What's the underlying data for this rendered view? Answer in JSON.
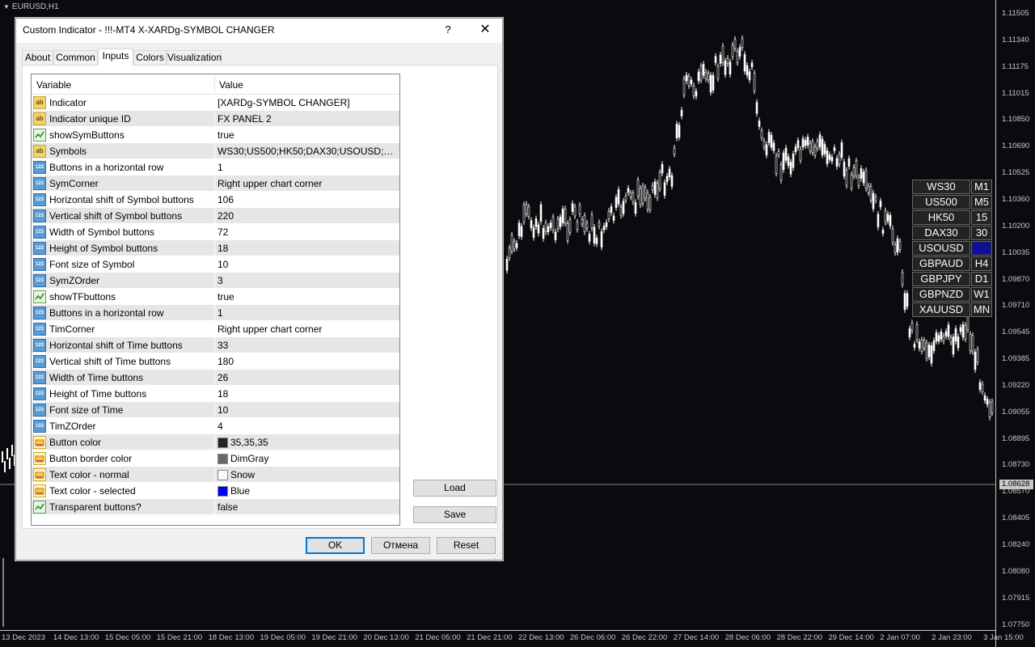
{
  "chart": {
    "title": "EURUSD,H1",
    "current_price": "1.08628",
    "price_labels": [
      "1.11505",
      "1.11340",
      "1.11175",
      "1.11015",
      "1.10850",
      "1.10690",
      "1.10525",
      "1.10360",
      "1.10200",
      "1.10035",
      "1.09870",
      "1.09710",
      "1.09545",
      "1.09385",
      "1.09220",
      "1.09055",
      "1.08895",
      "1.08730",
      "1.08570",
      "1.08405",
      "1.08240",
      "1.08080",
      "1.07915",
      "1.07750"
    ],
    "time_labels": [
      "13 Dec 2023",
      "14 Dec 13:00",
      "15 Dec 05:00",
      "15 Dec 21:00",
      "18 Dec 13:00",
      "19 Dec 05:00",
      "19 Dec 21:00",
      "20 Dec 13:00",
      "21 Dec 05:00",
      "21 Dec 21:00",
      "22 Dec 13:00",
      "26 Dec 06:00",
      "26 Dec 22:00",
      "27 Dec 14:00",
      "28 Dec 06:00",
      "28 Dec 22:00",
      "29 Dec 14:00",
      "2 Jan 07:00",
      "2 Jan 23:00",
      "3 Jan 15:00"
    ],
    "symbol_buttons": [
      "WS30",
      "US500",
      "HK50",
      "DAX30",
      "USOUSD",
      "GBPAUD",
      "GBPJPY",
      "GBPNZD",
      "XAUUSD"
    ],
    "timeframe_buttons": [
      "M1",
      "M5",
      "15",
      "30",
      "H1",
      "H4",
      "D1",
      "W1",
      "MN"
    ],
    "selected_timeframe": "H1",
    "colors": {
      "bg": "#0b0b0f",
      "candle": "#ffffff",
      "axis": "#c8c8c8",
      "button": "#232323",
      "button_border": "#696969",
      "text_normal": "#fffafa",
      "text_selected": "#0000ff"
    }
  },
  "dialog": {
    "title": "Custom Indicator - !!!-MT4 X-XARDg-SYMBOL CHANGER",
    "help": "?",
    "close": "✕",
    "tabs": [
      "About",
      "Common",
      "Inputs",
      "Colors",
      "Visualization"
    ],
    "active_tab": "Inputs",
    "grid": {
      "col_variable": "Variable",
      "col_value": "Value",
      "rows": [
        {
          "icon": "ab",
          "variable": "Indicator",
          "value": "[XARDg-SYMBOL CHANGER]"
        },
        {
          "icon": "ab",
          "variable": "Indicator unique ID",
          "value": "FX PANEL 2"
        },
        {
          "icon": "bool",
          "variable": "showSymButtons",
          "value": "true"
        },
        {
          "icon": "ab",
          "variable": "Symbols",
          "value": "WS30;US500;HK50;DAX30;USOUSD;GBP..."
        },
        {
          "icon": "num",
          "variable": "Buttons in a horizontal row",
          "value": "1"
        },
        {
          "icon": "num",
          "variable": "SymCorner",
          "value": "Right upper chart corner"
        },
        {
          "icon": "num",
          "variable": "Horizontal shift of Symbol buttons",
          "value": "106"
        },
        {
          "icon": "num",
          "variable": "Vertical shift of Symbol buttons",
          "value": "220"
        },
        {
          "icon": "num",
          "variable": "Width of Symbol buttons",
          "value": "72"
        },
        {
          "icon": "num",
          "variable": "Height of Symbol buttons",
          "value": "18"
        },
        {
          "icon": "num",
          "variable": "Font size of Symbol",
          "value": "10"
        },
        {
          "icon": "num",
          "variable": "SymZOrder",
          "value": "3"
        },
        {
          "icon": "bool",
          "variable": "showTFbuttons",
          "value": "true"
        },
        {
          "icon": "num",
          "variable": "Buttons in a horizontal row",
          "value": "1"
        },
        {
          "icon": "num",
          "variable": "TimCorner",
          "value": "Right upper chart corner"
        },
        {
          "icon": "num",
          "variable": "Horizontal shift of Time buttons",
          "value": "33"
        },
        {
          "icon": "num",
          "variable": "Vertical shift of Time buttons",
          "value": "180"
        },
        {
          "icon": "num",
          "variable": "Width of Time buttons",
          "value": "26"
        },
        {
          "icon": "num",
          "variable": "Height of Time buttons",
          "value": "18"
        },
        {
          "icon": "num",
          "variable": "Font size of Time",
          "value": "10"
        },
        {
          "icon": "num",
          "variable": "TimZOrder",
          "value": "4"
        },
        {
          "icon": "color",
          "variable": "Button color",
          "value": "35,35,35",
          "swatch": "#232323"
        },
        {
          "icon": "color",
          "variable": "Button border color",
          "value": "DimGray",
          "swatch": "#696969"
        },
        {
          "icon": "color",
          "variable": "Text color - normal",
          "value": "Snow",
          "swatch": "#fffafa"
        },
        {
          "icon": "color",
          "variable": "Text color - selected",
          "value": "Blue",
          "swatch": "#0000ff"
        },
        {
          "icon": "bool",
          "variable": "Transparent buttons?",
          "value": "false"
        }
      ]
    },
    "load_label": "Load",
    "save_label": "Save",
    "ok_label": "OK",
    "cancel_label": "Отмена",
    "reset_label": "Reset"
  }
}
